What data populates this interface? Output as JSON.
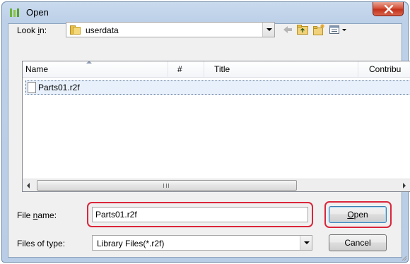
{
  "window": {
    "title": "Open"
  },
  "lookin": {
    "label_pre": "Look ",
    "label_mnemonic": "i",
    "label_post": "n:",
    "value": "userdata"
  },
  "toolbar": {
    "icons": [
      "back-arrow-icon",
      "up-folder-icon",
      "new-folder-icon",
      "view-menu-icon"
    ]
  },
  "file_list": {
    "columns": [
      "Name",
      "#",
      "Title",
      "Contribu"
    ],
    "files": [
      {
        "name": "Parts01.r2f"
      }
    ],
    "scrollbar_grip": "III"
  },
  "filename": {
    "label_pre": "File ",
    "label_mnemonic": "n",
    "label_post": "ame:",
    "value": "Parts01.r2f"
  },
  "filetype": {
    "label": "Files of type:",
    "value": "Library Files(*.r2f)"
  },
  "buttons": {
    "open_mnemonic": "O",
    "open_rest": "pen",
    "cancel": "Cancel"
  },
  "colors": {
    "highlight": "#d9263b",
    "selection": "#e8f1fb"
  }
}
